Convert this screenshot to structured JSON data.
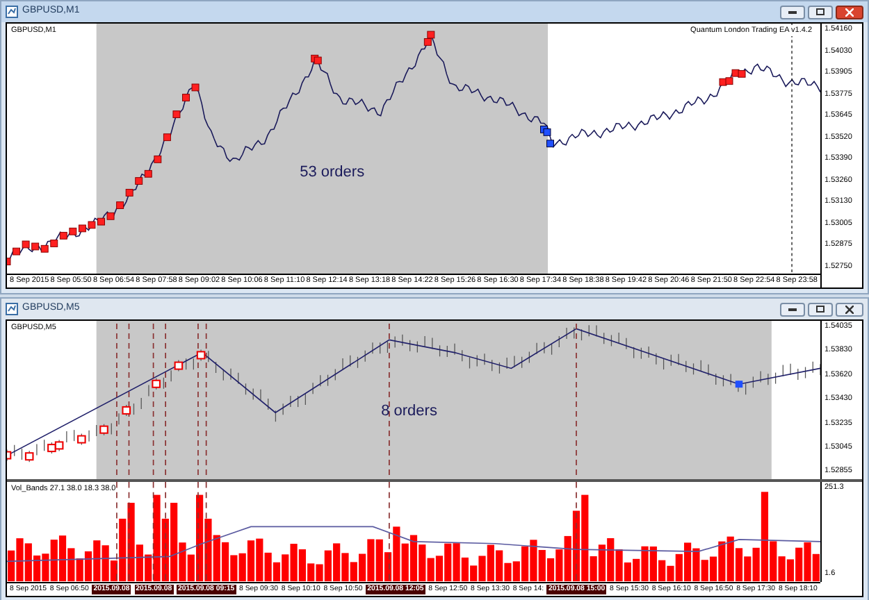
{
  "windows": [
    {
      "title": "GBPUSD,M1",
      "active": true,
      "symbol_label": "GBPUSD,M1",
      "ea_label": "Quantum London Trading EA v1.4.2",
      "orders_label": "53  orders",
      "price_ticks": [
        "1.54160",
        "1.54030",
        "1.53905",
        "1.53775",
        "1.53645",
        "1.53520",
        "1.53390",
        "1.53260",
        "1.53130",
        "1.53005",
        "1.52875",
        "1.52750"
      ],
      "time_ticks": [
        {
          "text": "8 Sep 2015",
          "highlighted": false
        },
        {
          "text": "8 Sep 05:50",
          "highlighted": false
        },
        {
          "text": "8 Sep 06:54",
          "highlighted": false
        },
        {
          "text": "8 Sep 07:58",
          "highlighted": false
        },
        {
          "text": "8 Sep 09:02",
          "highlighted": false
        },
        {
          "text": "8 Sep 10:06",
          "highlighted": false
        },
        {
          "text": "8 Sep 11:10",
          "highlighted": false
        },
        {
          "text": "8 Sep 12:14",
          "highlighted": false
        },
        {
          "text": "8 Sep 13:18",
          "highlighted": false
        },
        {
          "text": "8 Sep 14:22",
          "highlighted": false
        },
        {
          "text": "8 Sep 15:26",
          "highlighted": false
        },
        {
          "text": "8 Sep 16:30",
          "highlighted": false
        },
        {
          "text": "8 Sep 17:34",
          "highlighted": false
        },
        {
          "text": "8 Sep 18:38",
          "highlighted": false
        },
        {
          "text": "8 Sep 19:42",
          "highlighted": false
        },
        {
          "text": "8 Sep 20:46",
          "highlighted": false
        },
        {
          "text": "8 Sep 21:50",
          "highlighted": false
        },
        {
          "text": "8 Sep 22:54",
          "highlighted": false
        },
        {
          "text": "8 Sep 23:58",
          "highlighted": false
        }
      ]
    },
    {
      "title": "GBPUSD,M5",
      "active": false,
      "symbol_label": "GBPUSD,M5",
      "orders_label": "8  orders",
      "price_ticks": [
        "1.54035",
        "1.53830",
        "1.53620",
        "1.53430",
        "1.53235",
        "1.53045",
        "1.52855"
      ],
      "indicator": {
        "label": "Vol_Bands 27.1 38.0 18.3 38.0",
        "ticks": [
          "251.3",
          "1.6"
        ]
      },
      "time_ticks": [
        {
          "text": "8 Sep 2015",
          "highlighted": false
        },
        {
          "text": "8 Sep 06:50",
          "highlighted": false
        },
        {
          "text": "2015.09.08",
          "highlighted": true
        },
        {
          "text": "2015.09.08",
          "highlighted": true
        },
        {
          "text": "2015.09.08 09:15",
          "highlighted": true
        },
        {
          "text": "8 Sep 09:30",
          "highlighted": false
        },
        {
          "text": "8 Sep 10:10",
          "highlighted": false
        },
        {
          "text": "8 Sep 10:50",
          "highlighted": false
        },
        {
          "text": "2015.09.08 12:05",
          "highlighted": true
        },
        {
          "text": "8 Sep 12:50",
          "highlighted": false
        },
        {
          "text": "8 Sep 13:30",
          "highlighted": false
        },
        {
          "text": "8 Sep 14:",
          "highlighted": false
        },
        {
          "text": "2015.09.08 15:00",
          "highlighted": true
        },
        {
          "text": "8 Sep 15:30",
          "highlighted": false
        },
        {
          "text": "8 Sep 16:10",
          "highlighted": false
        },
        {
          "text": "8 Sep 16:50",
          "highlighted": false
        },
        {
          "text": "8 Sep 17:30",
          "highlighted": false
        },
        {
          "text": "8 Sep 18:10",
          "highlighted": false
        }
      ]
    }
  ]
}
